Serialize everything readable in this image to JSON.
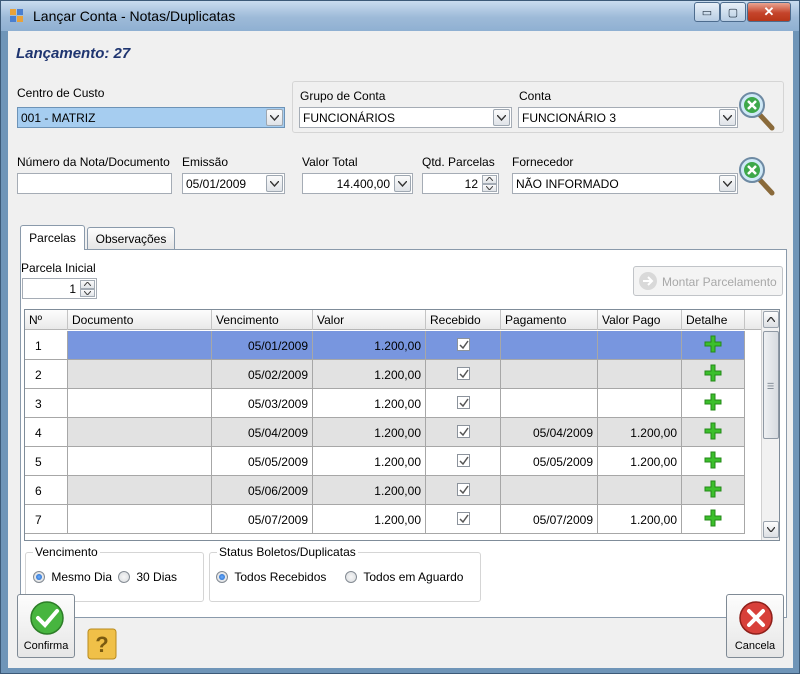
{
  "window": {
    "title": "Lançar Conta - Notas/Duplicatas",
    "controls": {
      "minimize": "▭",
      "maximize": "▢",
      "close": "✕"
    }
  },
  "header": {
    "lancamento": "Lançamento: 27"
  },
  "form": {
    "centro_custo": {
      "label": "Centro de Custo",
      "value": "001 - MATRIZ"
    },
    "grupo_conta": {
      "label": "Grupo de Conta",
      "value": "FUNCIONÁRIOS"
    },
    "conta": {
      "label": "Conta",
      "value": "FUNCIONÁRIO 3"
    },
    "numero_nota": {
      "label": "Número da Nota/Documento",
      "value": ""
    },
    "emissao": {
      "label": "Emissão",
      "value": "05/01/2009"
    },
    "valor_total": {
      "label": "Valor Total",
      "value": "14.400,00"
    },
    "qtd_parcelas": {
      "label": "Qtd. Parcelas",
      "value": "12"
    },
    "fornecedor": {
      "label": "Fornecedor",
      "value": "NÃO INFORMADO"
    }
  },
  "tabs": [
    {
      "label": "Parcelas"
    },
    {
      "label": "Observações"
    }
  ],
  "parcelas": {
    "parcela_inicial": {
      "label": "Parcela Inicial",
      "value": "1"
    },
    "montar_button": "Montar Parcelamento",
    "columns": [
      "Nº",
      "Documento",
      "Vencimento",
      "Valor",
      "Recebido",
      "Pagamento",
      "Valor Pago",
      "Detalhe"
    ],
    "rows": [
      {
        "n": "1",
        "documento": "",
        "vencimento": "05/01/2009",
        "valor": "1.200,00",
        "recebido": true,
        "pagamento": "",
        "valor_pago": ""
      },
      {
        "n": "2",
        "documento": "",
        "vencimento": "05/02/2009",
        "valor": "1.200,00",
        "recebido": true,
        "pagamento": "",
        "valor_pago": ""
      },
      {
        "n": "3",
        "documento": "",
        "vencimento": "05/03/2009",
        "valor": "1.200,00",
        "recebido": true,
        "pagamento": "",
        "valor_pago": ""
      },
      {
        "n": "4",
        "documento": "",
        "vencimento": "05/04/2009",
        "valor": "1.200,00",
        "recebido": true,
        "pagamento": "05/04/2009",
        "valor_pago": "1.200,00"
      },
      {
        "n": "5",
        "documento": "",
        "vencimento": "05/05/2009",
        "valor": "1.200,00",
        "recebido": true,
        "pagamento": "05/05/2009",
        "valor_pago": "1.200,00"
      },
      {
        "n": "6",
        "documento": "",
        "vencimento": "05/06/2009",
        "valor": "1.200,00",
        "recebido": true,
        "pagamento": "",
        "valor_pago": ""
      },
      {
        "n": "7",
        "documento": "",
        "vencimento": "05/07/2009",
        "valor": "1.200,00",
        "recebido": true,
        "pagamento": "05/07/2009",
        "valor_pago": "1.200,00"
      }
    ],
    "vencimento_group": {
      "label": "Vencimento",
      "options": [
        "Mesmo Dia",
        "30 Dias"
      ],
      "selected": "Mesmo Dia"
    },
    "status_group": {
      "label": "Status Boletos/Duplicatas",
      "options": [
        "Todos Recebidos",
        "Todos em Aguardo"
      ],
      "selected": "Todos Recebidos"
    }
  },
  "footer": {
    "confirma": "Confirma",
    "cancela": "Cancela"
  },
  "colors": {
    "selected_row": "#7896df",
    "alt_row": "#e2e2e2",
    "title_text": "#1f3570",
    "plus_green": "#3cbf2c"
  }
}
